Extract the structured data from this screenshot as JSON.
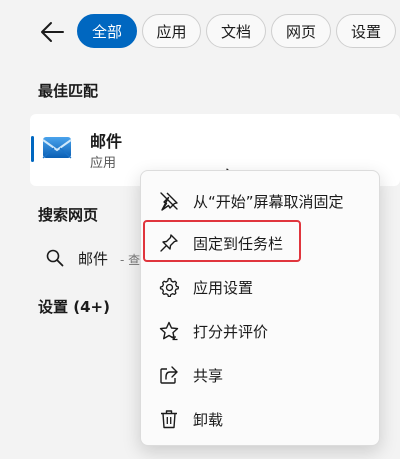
{
  "tabs": [
    {
      "label": "全部",
      "active": true
    },
    {
      "label": "应用",
      "active": false
    },
    {
      "label": "文档",
      "active": false
    },
    {
      "label": "网页",
      "active": false
    },
    {
      "label": "设置",
      "active": false
    }
  ],
  "sections": {
    "best_match": "最佳匹配",
    "search_web": "搜索网页",
    "settings": "设置 (4+)"
  },
  "best_match_app": {
    "name": "邮件",
    "type": "应用",
    "icon": "mail-icon"
  },
  "web_result": {
    "query": "邮件",
    "suffix": "- 查"
  },
  "context_menu": {
    "items": [
      {
        "label": "从“开始”屏幕取消固定",
        "icon": "unpin-icon"
      },
      {
        "label": "固定到任务栏",
        "icon": "pin-icon",
        "highlighted": true
      },
      {
        "label": "应用设置",
        "icon": "gear-icon"
      },
      {
        "label": "打分并评价",
        "icon": "star-icon"
      },
      {
        "label": "共享",
        "icon": "share-icon"
      },
      {
        "label": "卸载",
        "icon": "trash-icon"
      }
    ]
  },
  "colors": {
    "accent": "#0067c0",
    "highlight_border": "#e0353d",
    "background": "#f3f3f3"
  }
}
